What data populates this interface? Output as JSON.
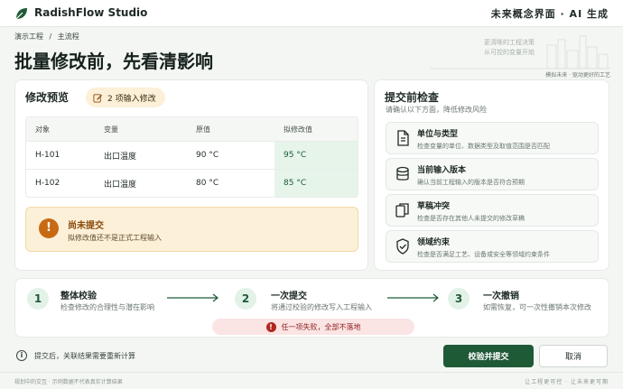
{
  "app": {
    "name": "RadishFlow Studio",
    "tagline": "未来概念界面 · AI 生成"
  },
  "breadcrumb": [
    "演示工程",
    "/",
    "主流程"
  ],
  "page": {
    "title": "批量修改前，先看清影响"
  },
  "hero": {
    "line1": "更清晰的工程决策",
    "line2": "从可控的变量开始",
    "caption": "模拟未来 · 驱动更好的工艺"
  },
  "preview": {
    "title": "修改预览",
    "badge": "2 项输入修改",
    "columns": [
      "对象",
      "变量",
      "原值",
      "拟修改值"
    ],
    "rows": [
      [
        "H-101",
        "出口温度",
        "90 °C",
        "95 °C"
      ],
      [
        "H-102",
        "出口温度",
        "80 °C",
        "85 °C"
      ]
    ],
    "alert": {
      "title": "尚未提交",
      "subtitle": "拟修改值还不是正式工程输入"
    }
  },
  "checks": {
    "title": "提交前检查",
    "subtitle": "请确认以下方面，降低修改风险",
    "items": [
      {
        "title": "单位与类型",
        "desc": "检查变量的单位、数据类型及取值范围是否匹配",
        "icon": "document-icon"
      },
      {
        "title": "当前输入版本",
        "desc": "确认当前工程输入的版本是否符合预期",
        "icon": "database-icon"
      },
      {
        "title": "草稿冲突",
        "desc": "检查是否存在其他人未提交的修改草稿",
        "icon": "copy-icon"
      },
      {
        "title": "领域约束",
        "desc": "检查是否满足工艺、设备或安全等领域约束条件",
        "icon": "shield-check-icon"
      }
    ]
  },
  "flow": {
    "steps": [
      {
        "num": "1",
        "title": "整体校验",
        "desc": "检查修改的合理性与潜在影响"
      },
      {
        "num": "2",
        "title": "一次提交",
        "desc": "将通过校验的修改写入工程输入"
      },
      {
        "num": "3",
        "title": "一次撤销",
        "desc": "如需恢复，可一次性撤销本次修改"
      }
    ],
    "warning": "任一项失败，全部不落地"
  },
  "footer": {
    "info": "提交后，关联结果需要重新计算",
    "submit": "校验并提交",
    "cancel": "取消"
  },
  "bottombar": {
    "left": "规划中的交互 · 示例数据不代表真实计算结果",
    "right": "让工程更可控 · 让未来更可期"
  },
  "colors": {
    "primary": "#1f5a37",
    "warning": "#c86a14",
    "danger": "#b3261e",
    "accent_bg": "#e6f4ea"
  }
}
